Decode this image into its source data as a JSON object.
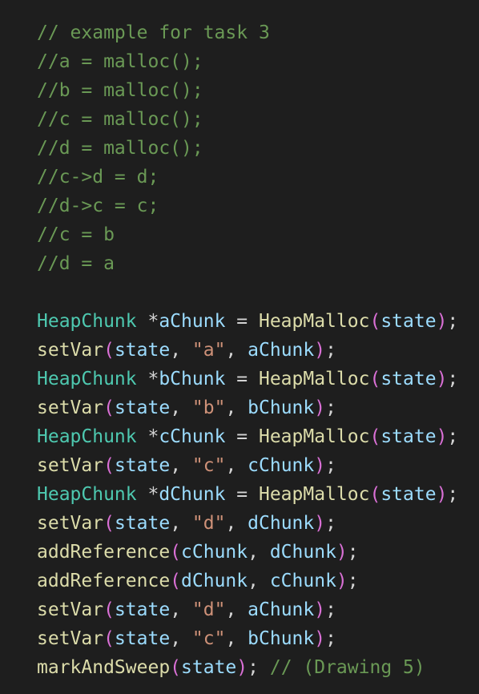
{
  "colors": {
    "background": "#1e1e1e",
    "comment": "#6a9955",
    "type": "#4ec9b0",
    "function": "#dcdcaa",
    "variable": "#9cdcfe",
    "string": "#ce9178",
    "default": "#d4d4d4",
    "paren": "#da70d6"
  },
  "code": {
    "lines": [
      [
        {
          "t": "// example for task 3",
          "k": "comment"
        }
      ],
      [
        {
          "t": "//a = malloc();",
          "k": "comment"
        }
      ],
      [
        {
          "t": "//b = malloc();",
          "k": "comment"
        }
      ],
      [
        {
          "t": "//c = malloc();",
          "k": "comment"
        }
      ],
      [
        {
          "t": "//d = malloc();",
          "k": "comment"
        }
      ],
      [
        {
          "t": "//c->d = d;",
          "k": "comment"
        }
      ],
      [
        {
          "t": "//d->c = c;",
          "k": "comment"
        }
      ],
      [
        {
          "t": "//c = b",
          "k": "comment"
        }
      ],
      [
        {
          "t": "//d = a",
          "k": "comment"
        }
      ],
      [],
      [
        {
          "t": "HeapChunk",
          "k": "type"
        },
        {
          "t": " *",
          "k": "punc"
        },
        {
          "t": "aChunk",
          "k": "var"
        },
        {
          "t": " = ",
          "k": "punc"
        },
        {
          "t": "HeapMalloc",
          "k": "func"
        },
        {
          "t": "(",
          "k": "paren"
        },
        {
          "t": "state",
          "k": "var"
        },
        {
          "t": ")",
          "k": "paren"
        },
        {
          "t": ";",
          "k": "punc"
        }
      ],
      [
        {
          "t": "setVar",
          "k": "func"
        },
        {
          "t": "(",
          "k": "paren"
        },
        {
          "t": "state",
          "k": "var"
        },
        {
          "t": ", ",
          "k": "punc"
        },
        {
          "t": "\"a\"",
          "k": "str"
        },
        {
          "t": ", ",
          "k": "punc"
        },
        {
          "t": "aChunk",
          "k": "var"
        },
        {
          "t": ")",
          "k": "paren"
        },
        {
          "t": ";",
          "k": "punc"
        }
      ],
      [
        {
          "t": "HeapChunk",
          "k": "type"
        },
        {
          "t": " *",
          "k": "punc"
        },
        {
          "t": "bChunk",
          "k": "var"
        },
        {
          "t": " = ",
          "k": "punc"
        },
        {
          "t": "HeapMalloc",
          "k": "func"
        },
        {
          "t": "(",
          "k": "paren"
        },
        {
          "t": "state",
          "k": "var"
        },
        {
          "t": ")",
          "k": "paren"
        },
        {
          "t": ";",
          "k": "punc"
        }
      ],
      [
        {
          "t": "setVar",
          "k": "func"
        },
        {
          "t": "(",
          "k": "paren"
        },
        {
          "t": "state",
          "k": "var"
        },
        {
          "t": ", ",
          "k": "punc"
        },
        {
          "t": "\"b\"",
          "k": "str"
        },
        {
          "t": ", ",
          "k": "punc"
        },
        {
          "t": "bChunk",
          "k": "var"
        },
        {
          "t": ")",
          "k": "paren"
        },
        {
          "t": ";",
          "k": "punc"
        }
      ],
      [
        {
          "t": "HeapChunk",
          "k": "type"
        },
        {
          "t": " *",
          "k": "punc"
        },
        {
          "t": "cChunk",
          "k": "var"
        },
        {
          "t": " = ",
          "k": "punc"
        },
        {
          "t": "HeapMalloc",
          "k": "func"
        },
        {
          "t": "(",
          "k": "paren"
        },
        {
          "t": "state",
          "k": "var"
        },
        {
          "t": ")",
          "k": "paren"
        },
        {
          "t": ";",
          "k": "punc"
        }
      ],
      [
        {
          "t": "setVar",
          "k": "func"
        },
        {
          "t": "(",
          "k": "paren"
        },
        {
          "t": "state",
          "k": "var"
        },
        {
          "t": ", ",
          "k": "punc"
        },
        {
          "t": "\"c\"",
          "k": "str"
        },
        {
          "t": ", ",
          "k": "punc"
        },
        {
          "t": "cChunk",
          "k": "var"
        },
        {
          "t": ")",
          "k": "paren"
        },
        {
          "t": ";",
          "k": "punc"
        }
      ],
      [
        {
          "t": "HeapChunk",
          "k": "type"
        },
        {
          "t": " *",
          "k": "punc"
        },
        {
          "t": "dChunk",
          "k": "var"
        },
        {
          "t": " = ",
          "k": "punc"
        },
        {
          "t": "HeapMalloc",
          "k": "func"
        },
        {
          "t": "(",
          "k": "paren"
        },
        {
          "t": "state",
          "k": "var"
        },
        {
          "t": ")",
          "k": "paren"
        },
        {
          "t": ";",
          "k": "punc"
        }
      ],
      [
        {
          "t": "setVar",
          "k": "func"
        },
        {
          "t": "(",
          "k": "paren"
        },
        {
          "t": "state",
          "k": "var"
        },
        {
          "t": ", ",
          "k": "punc"
        },
        {
          "t": "\"d\"",
          "k": "str"
        },
        {
          "t": ", ",
          "k": "punc"
        },
        {
          "t": "dChunk",
          "k": "var"
        },
        {
          "t": ")",
          "k": "paren"
        },
        {
          "t": ";",
          "k": "punc"
        }
      ],
      [
        {
          "t": "addReference",
          "k": "func"
        },
        {
          "t": "(",
          "k": "paren"
        },
        {
          "t": "cChunk",
          "k": "var"
        },
        {
          "t": ", ",
          "k": "punc"
        },
        {
          "t": "dChunk",
          "k": "var"
        },
        {
          "t": ")",
          "k": "paren"
        },
        {
          "t": ";",
          "k": "punc"
        }
      ],
      [
        {
          "t": "addReference",
          "k": "func"
        },
        {
          "t": "(",
          "k": "paren"
        },
        {
          "t": "dChunk",
          "k": "var"
        },
        {
          "t": ", ",
          "k": "punc"
        },
        {
          "t": "cChunk",
          "k": "var"
        },
        {
          "t": ")",
          "k": "paren"
        },
        {
          "t": ";",
          "k": "punc"
        }
      ],
      [
        {
          "t": "setVar",
          "k": "func"
        },
        {
          "t": "(",
          "k": "paren"
        },
        {
          "t": "state",
          "k": "var"
        },
        {
          "t": ", ",
          "k": "punc"
        },
        {
          "t": "\"d\"",
          "k": "str"
        },
        {
          "t": ", ",
          "k": "punc"
        },
        {
          "t": "aChunk",
          "k": "var"
        },
        {
          "t": ")",
          "k": "paren"
        },
        {
          "t": ";",
          "k": "punc"
        }
      ],
      [
        {
          "t": "setVar",
          "k": "func"
        },
        {
          "t": "(",
          "k": "paren"
        },
        {
          "t": "state",
          "k": "var"
        },
        {
          "t": ", ",
          "k": "punc"
        },
        {
          "t": "\"c\"",
          "k": "str"
        },
        {
          "t": ", ",
          "k": "punc"
        },
        {
          "t": "bChunk",
          "k": "var"
        },
        {
          "t": ")",
          "k": "paren"
        },
        {
          "t": ";",
          "k": "punc"
        }
      ],
      [
        {
          "t": "markAndSweep",
          "k": "func"
        },
        {
          "t": "(",
          "k": "paren"
        },
        {
          "t": "state",
          "k": "var"
        },
        {
          "t": ")",
          "k": "paren"
        },
        {
          "t": "; ",
          "k": "punc"
        },
        {
          "t": "// (Drawing 5)",
          "k": "comment"
        }
      ]
    ]
  }
}
